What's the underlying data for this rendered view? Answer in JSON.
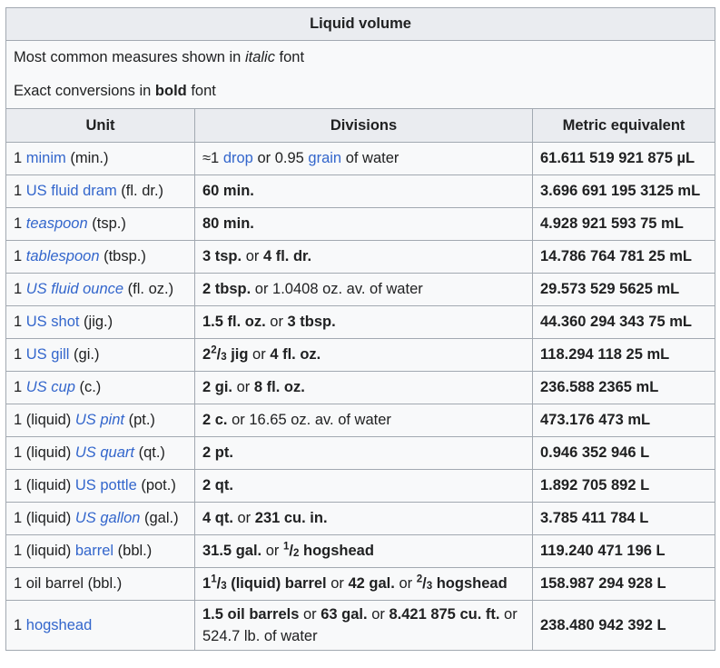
{
  "caption": "Liquid volume",
  "notes": {
    "line1_pre": "Most common measures shown in ",
    "line1_em": "italic",
    "line1_post": " font",
    "line2_pre": "Exact conversions in ",
    "line2_strong": "bold",
    "line2_post": " font"
  },
  "headers": [
    "Unit",
    "Divisions",
    "Metric equivalent"
  ],
  "rows": [
    {
      "unit": {
        "pre": "1 ",
        "link": "minim",
        "italic": false,
        "post": " (min.)"
      },
      "div": [
        {
          "t": "≈1 "
        },
        {
          "t": "drop",
          "link": true
        },
        {
          "t": " or 0.95 "
        },
        {
          "t": "grain",
          "link": true
        },
        {
          "t": " of water"
        }
      ],
      "metric": "61.611 519 921 875 µL"
    },
    {
      "unit": {
        "pre": "1 ",
        "link": "US fluid dram",
        "italic": false,
        "post": " (fl. dr.)"
      },
      "div": [
        {
          "t": "60 min.",
          "b": true
        }
      ],
      "metric": "3.696 691 195 3125 mL"
    },
    {
      "unit": {
        "pre": "1 ",
        "link": "teaspoon",
        "italic": true,
        "post": " (tsp.)"
      },
      "div": [
        {
          "t": "80 min.",
          "b": true
        }
      ],
      "metric": "4.928 921 593 75 mL"
    },
    {
      "unit": {
        "pre": "1 ",
        "link": "tablespoon",
        "italic": true,
        "post": " (tbsp.)"
      },
      "div": [
        {
          "t": "3 tsp.",
          "b": true
        },
        {
          "t": " or "
        },
        {
          "t": "4 fl. dr.",
          "b": true
        }
      ],
      "metric": "14.786 764 781 25 mL"
    },
    {
      "unit": {
        "pre": "1 ",
        "link": "US fluid ounce",
        "italic": true,
        "post": " (fl. oz.)"
      },
      "div": [
        {
          "t": "2 tbsp.",
          "b": true
        },
        {
          "t": " or 1.0408 oz. av. of water"
        }
      ],
      "metric": "29.573 529 5625 mL"
    },
    {
      "unit": {
        "pre": "1 ",
        "link": "US shot",
        "italic": false,
        "post": " (jig.)"
      },
      "div": [
        {
          "t": "1.5 fl. oz.",
          "b": true
        },
        {
          "t": " or "
        },
        {
          "t": "3 tbsp.",
          "b": true
        }
      ],
      "metric": "44.360 294 343 75 mL"
    },
    {
      "unit": {
        "pre": "1 ",
        "link": "US gill",
        "italic": false,
        "post": " (gi.)"
      },
      "div": [
        {
          "t": "2",
          "b": true
        },
        {
          "num": "2",
          "den": "3",
          "b": true
        },
        {
          "t": " jig",
          "b": true
        },
        {
          "t": " or "
        },
        {
          "t": "4 fl. oz.",
          "b": true
        }
      ],
      "metric": "118.294 118 25 mL"
    },
    {
      "unit": {
        "pre": "1 ",
        "link": "US cup",
        "italic": true,
        "post": " (c.)"
      },
      "div": [
        {
          "t": "2 gi.",
          "b": true
        },
        {
          "t": " or "
        },
        {
          "t": "8 fl. oz.",
          "b": true
        }
      ],
      "metric": "236.588 2365 mL"
    },
    {
      "unit": {
        "pre": "1 (liquid) ",
        "link": "US pint",
        "italic": true,
        "post": " (pt.)"
      },
      "div": [
        {
          "t": "2 c.",
          "b": true
        },
        {
          "t": " or 16.65 oz. av. of water"
        }
      ],
      "metric": "473.176 473 mL"
    },
    {
      "unit": {
        "pre": "1 (liquid) ",
        "link": "US quart",
        "italic": true,
        "post": " (qt.)"
      },
      "div": [
        {
          "t": "2 pt.",
          "b": true
        }
      ],
      "metric": "0.946 352 946 L"
    },
    {
      "unit": {
        "pre": "1 (liquid) ",
        "link": "US pottle",
        "italic": false,
        "post": " (pot.)"
      },
      "div": [
        {
          "t": "2 qt.",
          "b": true
        }
      ],
      "metric": "1.892 705 892 L"
    },
    {
      "unit": {
        "pre": "1 (liquid) ",
        "link": "US gallon",
        "italic": true,
        "post": " (gal.)"
      },
      "div": [
        {
          "t": "4 qt.",
          "b": true
        },
        {
          "t": " or "
        },
        {
          "t": "231 cu. in.",
          "b": true
        }
      ],
      "metric": "3.785 411 784 L"
    },
    {
      "unit": {
        "pre": "1 (liquid) ",
        "link": "barrel",
        "italic": false,
        "post": " (bbl.)"
      },
      "div": [
        {
          "t": "31.5 gal.",
          "b": true
        },
        {
          "t": " or "
        },
        {
          "num": "1",
          "den": "2",
          "b": true
        },
        {
          "t": " hogshead",
          "b": true
        }
      ],
      "metric": "119.240 471 196 L"
    },
    {
      "unit": {
        "pre": "1 oil barrel (bbl.)",
        "link": "",
        "italic": false,
        "post": ""
      },
      "div": [
        {
          "t": "1",
          "b": true
        },
        {
          "num": "1",
          "den": "3",
          "b": true
        },
        {
          "t": " (liquid) barrel",
          "b": true
        },
        {
          "t": " or "
        },
        {
          "t": "42 gal.",
          "b": true
        },
        {
          "t": " or "
        },
        {
          "num": "2",
          "den": "3",
          "b": true
        },
        {
          "t": " hogshead",
          "b": true
        }
      ],
      "metric": "158.987 294 928 L"
    },
    {
      "unit": {
        "pre": "1 ",
        "link": "hogshead",
        "italic": false,
        "post": ""
      },
      "div": [
        {
          "t": "1.5 oil barrels",
          "b": true
        },
        {
          "t": " or "
        },
        {
          "t": "63 gal.",
          "b": true
        },
        {
          "t": " or "
        },
        {
          "t": "8.421 875 cu. ft.",
          "b": true
        },
        {
          "t": " or 524.7 lb. of water"
        }
      ],
      "metric": "238.480 942 392 L",
      "tall": true
    }
  ],
  "colors": {
    "link": "#3366cc",
    "border": "#a2a9b1",
    "header_bg": "#eaecf0",
    "cell_bg": "#f8f9fa",
    "text": "#202122"
  }
}
